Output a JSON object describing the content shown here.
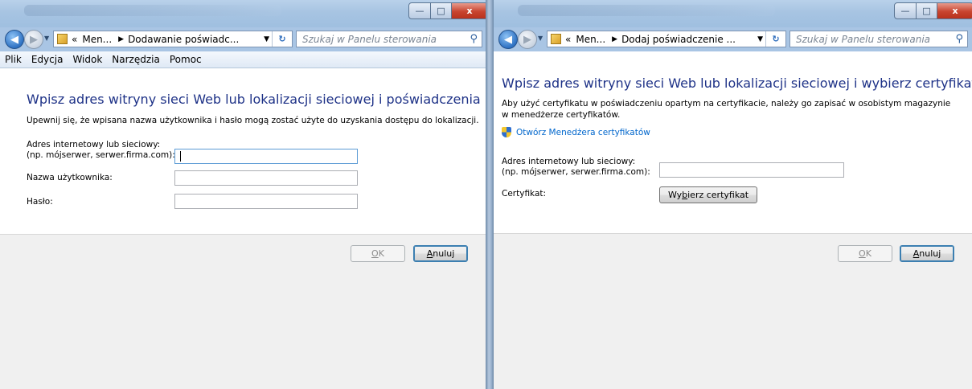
{
  "left": {
    "breadcrumb": [
      "Men...",
      "Dodawanie poświadc..."
    ],
    "search_placeholder": "Szukaj w Panelu sterowania",
    "menu": [
      "Plik",
      "Edycja",
      "Widok",
      "Narzędzia",
      "Pomoc"
    ],
    "heading": "Wpisz adres witryny sieci Web lub lokalizacji sieciowej i poświadczenia użytkownika",
    "description": "Upewnij się, że wpisana nazwa użytkownika i hasło mogą zostać użyte do uzyskania dostępu do lokalizacji.",
    "address_label_line1": "Adres internetowy lub sieciowy:",
    "address_label_line2": "(np. mójserwer, serwer.firma.com):",
    "address_value": "",
    "username_label": "Nazwa użytkownika:",
    "username_value": "",
    "password_label": "Hasło:",
    "password_value": "",
    "ok_mnemonic": "O",
    "ok_rest": "K",
    "cancel_mnemonic": "A",
    "cancel_rest": "nuluj"
  },
  "right": {
    "breadcrumb": [
      "Men...",
      "Dodaj poświadczenie ..."
    ],
    "search_placeholder": "Szukaj w Panelu sterowania",
    "heading": "Wpisz adres witryny sieci Web lub lokalizacji sieciowej i wybierz certyfikat",
    "description": "Aby użyć certyfikatu w poświadczeniu opartym na certyfikacie, należy go zapisać w osobistym magazynie w menedżerze certyfikatów.",
    "cert_manager_link": "Otwórz Menedżera certyfikatów",
    "address_label_line1": "Adres internetowy lub sieciowy:",
    "address_label_line2": "(np. mójserwer, serwer.firma.com):",
    "address_value": "",
    "certificate_label": "Certyfikat:",
    "choose_cert_pre": "Wy",
    "choose_cert_mnemonic": "b",
    "choose_cert_post": "ierz certyfikat",
    "ok_mnemonic": "O",
    "ok_rest": "K",
    "cancel_mnemonic": "A",
    "cancel_rest": "nuluj"
  },
  "window_controls": {
    "minimize": "—",
    "maximize": "□",
    "close": "x"
  },
  "colors": {
    "heading": "#1e3287",
    "link": "#0066cc",
    "chrome": "#a9c5e4"
  }
}
